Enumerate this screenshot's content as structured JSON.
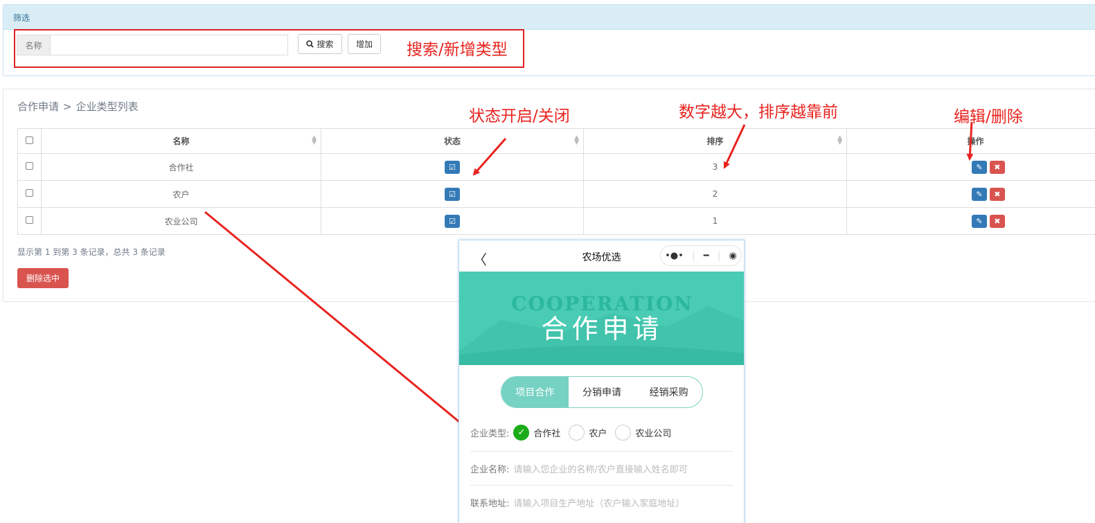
{
  "filter": {
    "panel_title": "筛选",
    "name_label": "名称",
    "name_value": "",
    "search_label": "搜索",
    "add_label": "增加"
  },
  "list": {
    "breadcrumb_parent": "合作申请",
    "breadcrumb_separator": ">",
    "breadcrumb_current": "企业类型列表",
    "columns": [
      "名称",
      "状态",
      "排序",
      "操作"
    ],
    "rows": [
      {
        "name": "合作社",
        "status_enabled": true,
        "sort": "3"
      },
      {
        "name": "农户",
        "status_enabled": true,
        "sort": "2"
      },
      {
        "name": "农业公司",
        "status_enabled": true,
        "sort": "1"
      }
    ],
    "summary": "显示第 1 到第 3 条记录，总共 3 条记录",
    "delete_selected_label": "删除选中"
  },
  "annotations": {
    "search_add": "搜索/新增类型",
    "status_toggle": "状态开启/关闭",
    "sort_hint": "数字越大，排序越靠前",
    "edit_delete": "编辑/删除",
    "color": "#e8231f"
  },
  "phone": {
    "title": "农场优选",
    "banner_en": "COOPERATION",
    "banner_cn": "合作申请",
    "tabs": [
      "项目合作",
      "分销申请",
      "经销采购"
    ],
    "active_tab": 0,
    "company_type_label": "企业类型:",
    "company_types": [
      "合作社",
      "农户",
      "农业公司"
    ],
    "selected_type": 0,
    "company_name_label": "企业名称:",
    "company_name_placeholder": "请输入您企业的名称/农户直接输入姓名即可",
    "address_label": "联系地址:",
    "address_placeholder": "请输入项目生产地址（农户输入家庭地址）",
    "accent_color": "#4acbb4",
    "check_color": "#1aad19"
  }
}
